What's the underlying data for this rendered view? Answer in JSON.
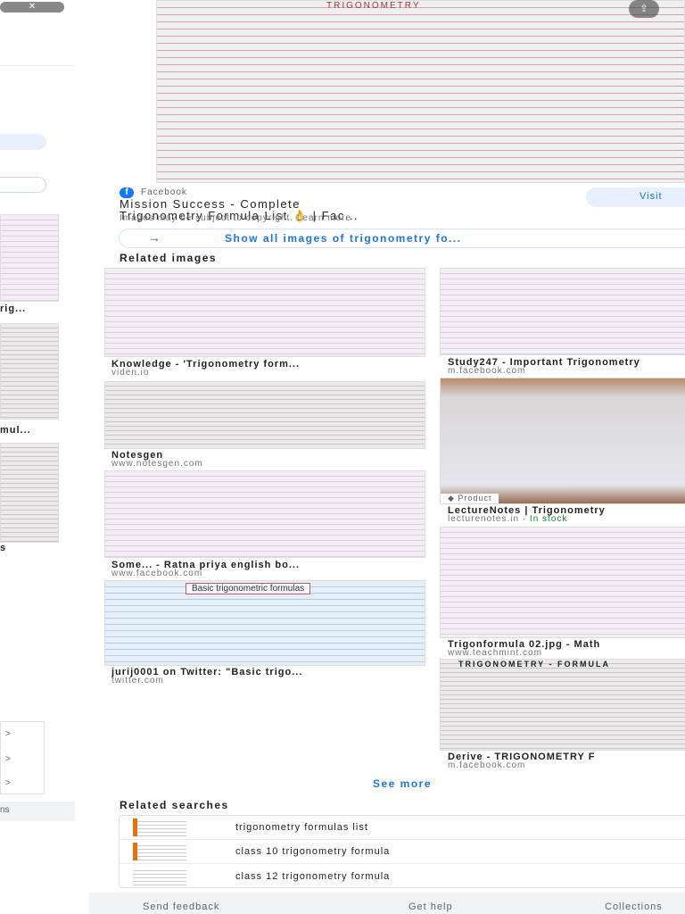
{
  "left_panel": {
    "captions": [
      "rig...",
      "mul...",
      "s"
    ],
    "footer_text": "ns",
    "chevron": ">"
  },
  "preview": {
    "source": "Facebook",
    "title_line1": "Mission Success - Complete",
    "title_line2": "Trigonometry Formula List 👌 | Fac...",
    "copyright": "Images may be subject to copyright. Learn more",
    "visit_label": "Visit",
    "show_all_label": "Show all images of trigonometry fo...",
    "image_title": "TRIGONOMETRY"
  },
  "related_images": {
    "heading": "Related images",
    "left": [
      {
        "title": "Knowledge - 'Trigonometry form...",
        "source": "viden.io"
      },
      {
        "title": "Notesgen",
        "source": "www.notesgen.com"
      },
      {
        "title": "Some... - Ratna priya english bo...",
        "source": "www.facebook.com"
      },
      {
        "title": "jurij0001 on Twitter: \"Basic trigo...",
        "source": "twitter.com",
        "overlay": "Basic trigonometric formulas"
      }
    ],
    "right": [
      {
        "title": "Study247 - Important Trigonometry",
        "source": "m.facebook.com"
      },
      {
        "title": "LectureNotes | Trigonometry",
        "source": "lecturenotes.in",
        "stock": "· In stock",
        "badge": "Product"
      },
      {
        "title": "Trigonformula 02.jpg - Math",
        "source": "www.teachmint.com"
      },
      {
        "title": "Derive - TRIGONOMETRY F",
        "source": "m.facebook.com",
        "overlay": "TRIGONOMETRY - FORMULA"
      }
    ]
  },
  "see_more": "See more",
  "related_searches": {
    "heading": "Related searches",
    "items": [
      "trigonometry formulas list",
      "class 10 trigonometry formula",
      "class 12 trigonometry formula"
    ]
  },
  "footer": {
    "send_feedback": "Send feedback",
    "get_help": "Get help",
    "collections": "Collections"
  },
  "colors": {
    "link": "#1a73e8",
    "stock": "#188038",
    "facebook": "#1877f2"
  }
}
